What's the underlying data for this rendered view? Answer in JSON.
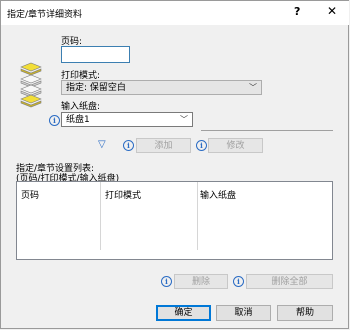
{
  "window": {
    "title": "指定/章节详细资料",
    "help_glyph": "?",
    "close_glyph": "✕"
  },
  "form": {
    "page_label": "页码:",
    "page_value": "",
    "print_mode_label": "打印模式:",
    "print_mode_value": "指定: 保留空白",
    "input_tray_label": "输入纸盘:",
    "input_tray_value": "纸盘1"
  },
  "actions": {
    "add_label": "添加",
    "modify_label": "修改"
  },
  "list": {
    "title_line1": "指定/章节设置列表:",
    "title_line2": "(页码/打印模式/输入纸盘)",
    "columns": [
      "页码",
      "打印模式",
      "输入纸盘"
    ],
    "rows": []
  },
  "list_actions": {
    "delete_label": "删除",
    "delete_all_label": "删除全部"
  },
  "footer": {
    "ok_label": "确定",
    "cancel_label": "取消",
    "help_label": "帮助"
  },
  "icons": {
    "info": "i",
    "dropdown": "﹀",
    "down_arrow": "▽"
  },
  "colors": {
    "accent": "#0078d7",
    "info_blue": "#2b6cc4"
  }
}
